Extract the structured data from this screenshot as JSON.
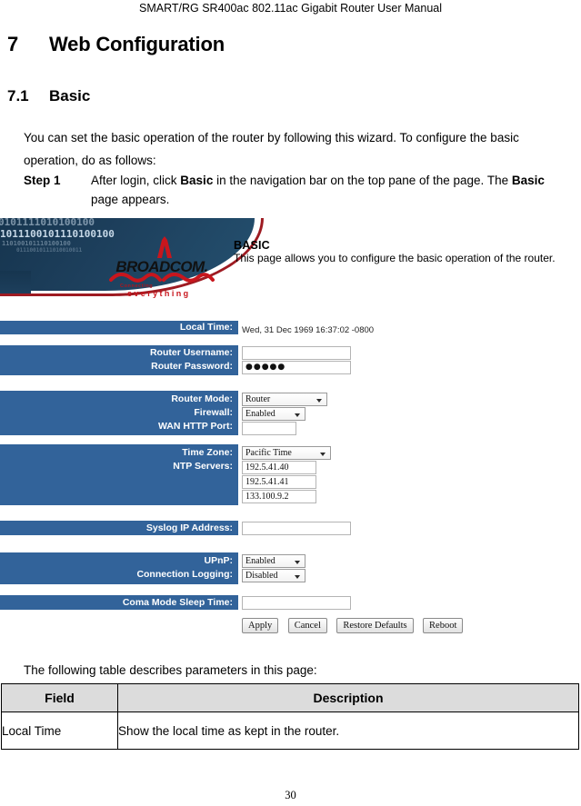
{
  "running_head": "SMART/RG SR400ac 802.11ac Gigabit Router User Manual",
  "chapter": {
    "number": "7",
    "title": "Web Configuration"
  },
  "section": {
    "number": "7.1",
    "title": "Basic"
  },
  "intro_paragraph": "You can set the basic operation of the router by following this wizard. To configure the basic operation, do as follows:",
  "step": {
    "label": "Step 1",
    "text_1": "After login, click ",
    "bold_1": "Basic",
    "text_2": " in the navigation bar on the top pane of the page. The ",
    "bold_2": "Basic",
    "text_3": " page appears."
  },
  "screenshot": {
    "banner": {
      "bits_line_1": "0101111010100100",
      "bits_line_2": "1011100101110100100",
      "bits_line_3": "110100101110100100",
      "bits_line_4": "01110010111010010011",
      "logo_word": "BROADCOM.",
      "logo_tagline_top": "Connecting",
      "logo_tagline_bottom": "everything",
      "page_title": "BASIC",
      "page_subtitle": "This page allows you to configure the basic operation of the router."
    },
    "rows": [
      {
        "labels": [
          "Local Time:"
        ],
        "values": [
          {
            "kind": "text",
            "value": "Wed, 31 Dec 1969 16:37:02 -0800"
          }
        ]
      },
      {
        "labels": [
          "Router Username:",
          "Router Password:"
        ],
        "values": [
          {
            "kind": "input",
            "value": "",
            "width": "w120"
          },
          {
            "kind": "password",
            "value": "●●●●●",
            "width": "w120"
          }
        ]
      },
      {
        "labels": [
          "Router Mode:",
          "Firewall:",
          "WAN HTTP Port:"
        ],
        "values": [
          {
            "kind": "select",
            "value": "Router",
            "width": "w94"
          },
          {
            "kind": "select",
            "value": "Enabled",
            "width": "w70"
          },
          {
            "kind": "input",
            "value": "",
            "width": "w60"
          }
        ]
      },
      {
        "labels": [
          "Time Zone:",
          "NTP Servers:"
        ],
        "values": [
          {
            "kind": "select",
            "value": "Pacific Time",
            "width": "w98"
          },
          {
            "kind": "input",
            "value": "192.5.41.40",
            "width": "w82"
          },
          {
            "kind": "input",
            "value": "192.5.41.41",
            "width": "w82"
          },
          {
            "kind": "input",
            "value": "133.100.9.2",
            "width": "w82"
          }
        ]
      },
      {
        "labels": [
          "Syslog IP Address:"
        ],
        "values": [
          {
            "kind": "input",
            "value": "",
            "width": "w120"
          }
        ]
      },
      {
        "labels": [
          "UPnP:",
          "Connection Logging:"
        ],
        "values": [
          {
            "kind": "select",
            "value": "Enabled",
            "width": "w70"
          },
          {
            "kind": "select",
            "value": "Disabled",
            "width": "w70"
          }
        ]
      },
      {
        "labels": [
          "Coma Mode Sleep Time:"
        ],
        "values": [
          {
            "kind": "input",
            "value": "",
            "width": "w120"
          }
        ]
      }
    ],
    "buttons": [
      "Apply",
      "Cancel",
      "Restore Defaults",
      "Reboot"
    ],
    "colors": {
      "label_bar_blue": "#32639a",
      "banner_navy": "#1d3f5c",
      "banner_red": "#9e1b22",
      "logo_red": "#c8161d"
    }
  },
  "table_lead": "The following table describes parameters in this page:",
  "params_table": {
    "headers": [
      "Field",
      "Description"
    ],
    "rows": [
      {
        "field": "Local Time",
        "description": "Show the local time as kept in the router."
      }
    ]
  },
  "folio": "30"
}
